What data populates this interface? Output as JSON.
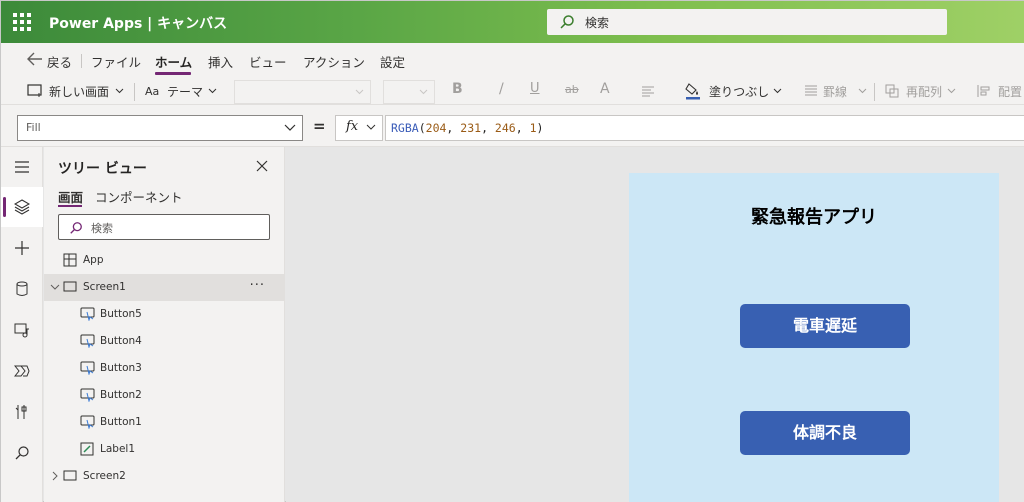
{
  "app_header": {
    "title": "Power Apps | キャンバス",
    "search_placeholder": "検索"
  },
  "menubar": {
    "back": "戻る",
    "items": [
      "ファイル",
      "ホーム",
      "挿入",
      "ビュー",
      "アクション",
      "設定"
    ],
    "active": "ホーム",
    "accent_color": "#742774"
  },
  "ribbon": {
    "new_screen": "新しい画面",
    "theme": "テーマ",
    "bold": "B",
    "italic": "/",
    "underline": "U",
    "strikethrough": "ab",
    "font_color": "A",
    "fill": "塗りつぶし",
    "border": "罫線",
    "reorder": "再配列",
    "align": "配置"
  },
  "formula_bar": {
    "property": "Fill",
    "equals": "=",
    "fx": "fx",
    "formula_fn": "RGBA",
    "formula_args": [
      "204",
      "231",
      "246",
      "1"
    ]
  },
  "tree_view": {
    "title": "ツリー ビュー",
    "tabs": [
      "画面",
      "コンポーネント"
    ],
    "active_tab": "画面",
    "search_placeholder": "検索",
    "nodes": [
      {
        "label": "App",
        "type": "app"
      },
      {
        "label": "Screen1",
        "type": "screen",
        "expanded": true,
        "selected": true,
        "more": "···"
      },
      {
        "label": "Button5",
        "type": "button"
      },
      {
        "label": "Button4",
        "type": "button"
      },
      {
        "label": "Button3",
        "type": "button"
      },
      {
        "label": "Button2",
        "type": "button"
      },
      {
        "label": "Button1",
        "type": "button"
      },
      {
        "label": "Label1",
        "type": "label"
      },
      {
        "label": "Screen2",
        "type": "screen",
        "expanded": false
      }
    ]
  },
  "canvas": {
    "screen_fill": "#cce7f6",
    "heading": "緊急報告アプリ",
    "buttons": [
      "電車遅延",
      "体調不良"
    ],
    "button_color": "#3860b2"
  },
  "left_rail": {
    "icons": [
      "menu-icon",
      "layers-icon",
      "insert-plus-icon",
      "data-icon",
      "media-icon",
      "power-automate-icon",
      "tools-icon",
      "search-icon"
    ],
    "active": "layers-icon"
  }
}
